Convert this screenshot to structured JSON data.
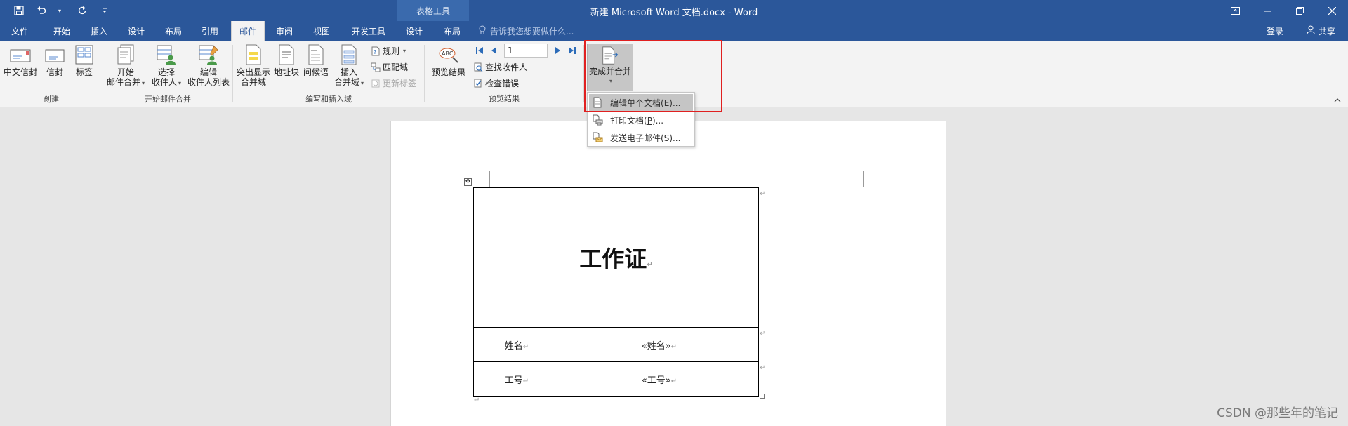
{
  "window": {
    "title": "新建 Microsoft Word 文档.docx - Word",
    "context_tools_label": "表格工具",
    "controls": [
      "restore-ribbon-icon",
      "minimize-icon",
      "maximize-icon",
      "close-icon"
    ]
  },
  "tabs": {
    "file": "文件",
    "home": "开始",
    "insert": "插入",
    "design": "设计",
    "layout": "布局",
    "references": "引用",
    "mailings": "邮件",
    "review": "审阅",
    "view": "视图",
    "developer": "开发工具",
    "table_design": "设计",
    "table_layout": "布局",
    "active": "邮件"
  },
  "tellme": {
    "placeholder": "告诉我您想要做什么..."
  },
  "account": {
    "login": "登录",
    "share": "共享"
  },
  "ribbon": {
    "create": {
      "label": "创建",
      "envelopes_cn": "中文信封",
      "envelopes": "信封",
      "labels": "标签"
    },
    "start_merge": {
      "label": "开始邮件合并",
      "start_l1": "开始",
      "start_l2": "邮件合并",
      "select_l1": "选择",
      "select_l2": "收件人",
      "edit_l1": "编辑",
      "edit_l2": "收件人列表"
    },
    "write_insert": {
      "label": "编写和插入域",
      "highlight_l1": "突出显示",
      "highlight_l2": "合并域",
      "address": "地址块",
      "greeting": "问候语",
      "insert_l1": "插入",
      "insert_l2": "合并域",
      "rules": "规则",
      "match": "匹配域",
      "update": "更新标签"
    },
    "preview": {
      "label": "预览结果",
      "preview_btn": "预览结果",
      "record": "1",
      "find": "查找收件人",
      "check": "检查错误"
    },
    "finish": {
      "label": "完成并合并",
      "menu": [
        {
          "text": "编辑单个文档(",
          "key": "E",
          "tail": ")...",
          "icon": "edit-document-icon"
        },
        {
          "text": "打印文档(",
          "key": "P",
          "tail": ")...",
          "icon": "print-document-icon"
        },
        {
          "text": "发送电子邮件(",
          "key": "S",
          "tail": ")...",
          "icon": "send-email-icon"
        }
      ]
    }
  },
  "document": {
    "title": "工作证",
    "row1_label": "姓名",
    "row1_field": "«姓名»",
    "row2_label": "工号",
    "row2_field": "«工号»",
    "para_mark": "↵"
  },
  "watermark": "CSDN @那些年的笔记",
  "colors": {
    "ribbon_blue": "#2b579a",
    "highlight_box": "#e02020"
  }
}
